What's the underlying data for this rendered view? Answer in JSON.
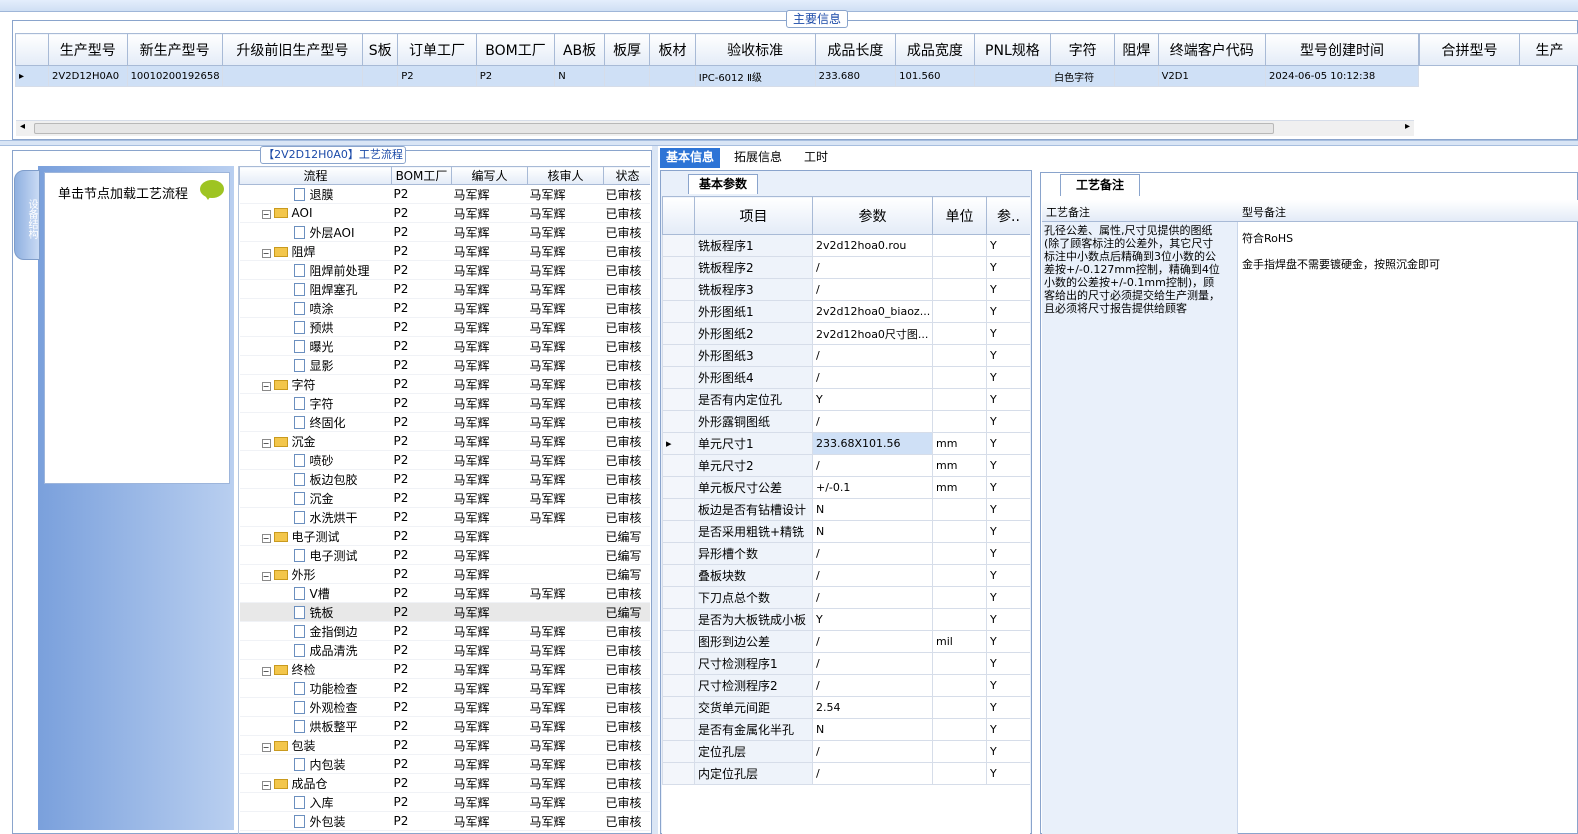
{
  "main_legend": "主要信息",
  "main_grid": {
    "columns": [
      "生产型号",
      "新生产型号",
      "升级前旧生产型号",
      "S板",
      "订单工厂",
      "BOM工厂",
      "AB板",
      "板厚",
      "板材",
      "验收标准",
      "成品长度",
      "成品宽度",
      "PNL规格",
      "字符",
      "阻焊",
      "终端客户代码",
      "型号创建时间"
    ],
    "row": [
      "2V2D12H0A0",
      "10010200192658",
      "",
      "",
      "P2",
      "P2",
      "N",
      "",
      "",
      "IPC-6012 Ⅱ级",
      "233.680",
      "101.560",
      "",
      "白色字符",
      "",
      "V2D1",
      "2024-06-05 10:12:38"
    ]
  },
  "right_grid_columns": [
    "合拼型号",
    "生产"
  ],
  "flow": {
    "legend": "【2V2D12H0A0】工艺流程",
    "sidebar_tab": "设备结构",
    "hint": "单击节点加载工艺流程",
    "columns": [
      "流程",
      "BOM工厂",
      "编写人",
      "核审人",
      "状态"
    ],
    "rows": [
      {
        "name": "退膜",
        "type": "doc",
        "bom": "P2",
        "author": "马军辉",
        "reviewer": "马军辉",
        "status": "已审核"
      },
      {
        "name": "AOI",
        "type": "folder",
        "bom": "P2",
        "author": "马军辉",
        "reviewer": "马军辉",
        "status": "已审核"
      },
      {
        "name": "外层AOI",
        "type": "doc",
        "bom": "P2",
        "author": "马军辉",
        "reviewer": "马军辉",
        "status": "已审核"
      },
      {
        "name": "阻焊",
        "type": "folder",
        "bom": "P2",
        "author": "马军辉",
        "reviewer": "马军辉",
        "status": "已审核"
      },
      {
        "name": "阻焊前处理",
        "type": "doc",
        "bom": "P2",
        "author": "马军辉",
        "reviewer": "马军辉",
        "status": "已审核"
      },
      {
        "name": "阻焊塞孔",
        "type": "doc",
        "bom": "P2",
        "author": "马军辉",
        "reviewer": "马军辉",
        "status": "已审核"
      },
      {
        "name": "喷涂",
        "type": "doc",
        "bom": "P2",
        "author": "马军辉",
        "reviewer": "马军辉",
        "status": "已审核"
      },
      {
        "name": "预烘",
        "type": "doc",
        "bom": "P2",
        "author": "马军辉",
        "reviewer": "马军辉",
        "status": "已审核"
      },
      {
        "name": "曝光",
        "type": "doc",
        "bom": "P2",
        "author": "马军辉",
        "reviewer": "马军辉",
        "status": "已审核"
      },
      {
        "name": "显影",
        "type": "doc",
        "bom": "P2",
        "author": "马军辉",
        "reviewer": "马军辉",
        "status": "已审核"
      },
      {
        "name": "字符",
        "type": "folder",
        "bom": "P2",
        "author": "马军辉",
        "reviewer": "马军辉",
        "status": "已审核"
      },
      {
        "name": "字符",
        "type": "doc",
        "bom": "P2",
        "author": "马军辉",
        "reviewer": "马军辉",
        "status": "已审核"
      },
      {
        "name": "终固化",
        "type": "doc",
        "bom": "P2",
        "author": "马军辉",
        "reviewer": "马军辉",
        "status": "已审核"
      },
      {
        "name": "沉金",
        "type": "folder",
        "bom": "P2",
        "author": "马军辉",
        "reviewer": "马军辉",
        "status": "已审核"
      },
      {
        "name": "喷砂",
        "type": "doc",
        "bom": "P2",
        "author": "马军辉",
        "reviewer": "马军辉",
        "status": "已审核"
      },
      {
        "name": "板边包胶",
        "type": "doc",
        "bom": "P2",
        "author": "马军辉",
        "reviewer": "马军辉",
        "status": "已审核"
      },
      {
        "name": "沉金",
        "type": "doc",
        "bom": "P2",
        "author": "马军辉",
        "reviewer": "马军辉",
        "status": "已审核"
      },
      {
        "name": "水洗烘干",
        "type": "doc",
        "bom": "P2",
        "author": "马军辉",
        "reviewer": "马军辉",
        "status": "已审核"
      },
      {
        "name": "电子测试",
        "type": "folder",
        "bom": "P2",
        "author": "马军辉",
        "reviewer": "",
        "status": "已编写"
      },
      {
        "name": "电子测试",
        "type": "doc",
        "bom": "P2",
        "author": "马军辉",
        "reviewer": "",
        "status": "已编写"
      },
      {
        "name": "外形",
        "type": "folder",
        "bom": "P2",
        "author": "马军辉",
        "reviewer": "",
        "status": "已编写"
      },
      {
        "name": "V槽",
        "type": "doc",
        "bom": "P2",
        "author": "马军辉",
        "reviewer": "马军辉",
        "status": "已审核"
      },
      {
        "name": "铣板",
        "type": "doc",
        "bom": "P2",
        "author": "马军辉",
        "reviewer": "",
        "status": "已编写",
        "selected": true
      },
      {
        "name": "金指倒边",
        "type": "doc",
        "bom": "P2",
        "author": "马军辉",
        "reviewer": "马军辉",
        "status": "已审核"
      },
      {
        "name": "成品清洗",
        "type": "doc",
        "bom": "P2",
        "author": "马军辉",
        "reviewer": "马军辉",
        "status": "已审核"
      },
      {
        "name": "终检",
        "type": "folder",
        "bom": "P2",
        "author": "马军辉",
        "reviewer": "马军辉",
        "status": "已审核"
      },
      {
        "name": "功能检查",
        "type": "doc",
        "bom": "P2",
        "author": "马军辉",
        "reviewer": "马军辉",
        "status": "已审核"
      },
      {
        "name": "外观检查",
        "type": "doc",
        "bom": "P2",
        "author": "马军辉",
        "reviewer": "马军辉",
        "status": "已审核"
      },
      {
        "name": "烘板整平",
        "type": "doc",
        "bom": "P2",
        "author": "马军辉",
        "reviewer": "马军辉",
        "status": "已审核"
      },
      {
        "name": "包装",
        "type": "folder",
        "bom": "P2",
        "author": "马军辉",
        "reviewer": "马军辉",
        "status": "已审核"
      },
      {
        "name": "内包装",
        "type": "doc",
        "bom": "P2",
        "author": "马军辉",
        "reviewer": "马军辉",
        "status": "已审核"
      },
      {
        "name": "成品仓",
        "type": "folder",
        "bom": "P2",
        "author": "马军辉",
        "reviewer": "马军辉",
        "status": "已审核"
      },
      {
        "name": "入库",
        "type": "doc",
        "bom": "P2",
        "author": "马军辉",
        "reviewer": "马军辉",
        "status": "已审核"
      },
      {
        "name": "外包装",
        "type": "doc",
        "bom": "P2",
        "author": "马军辉",
        "reviewer": "马军辉",
        "status": "已审核"
      }
    ]
  },
  "tabs": [
    "基本信息",
    "拓展信息",
    "工时"
  ],
  "param_tab": "基本参数",
  "param_grid": {
    "columns": [
      "项目",
      "参数",
      "单位",
      "参.."
    ],
    "rows": [
      {
        "item": "铣板程序1",
        "value": "2v2d12hoa0.rou",
        "unit": "",
        "flag": "Y"
      },
      {
        "item": "铣板程序2",
        "value": "/",
        "unit": "",
        "flag": "Y"
      },
      {
        "item": "铣板程序3",
        "value": "/",
        "unit": "",
        "flag": "Y"
      },
      {
        "item": "外形图纸1",
        "value": "2v2d12hoa0_biaoz...",
        "unit": "",
        "flag": "Y"
      },
      {
        "item": "外形图纸2",
        "value": "2v2d12hoa0尺寸图...",
        "unit": "",
        "flag": "Y"
      },
      {
        "item": "外形图纸3",
        "value": "/",
        "unit": "",
        "flag": "Y"
      },
      {
        "item": "外形图纸4",
        "value": "/",
        "unit": "",
        "flag": "Y"
      },
      {
        "item": "是否有内定位孔",
        "value": "Y",
        "unit": "",
        "flag": "Y"
      },
      {
        "item": "外形露铜图纸",
        "value": "/",
        "unit": "",
        "flag": "Y"
      },
      {
        "item": "单元尺寸1",
        "value": "233.68X101.56",
        "unit": "mm",
        "flag": "Y",
        "selected": true
      },
      {
        "item": "单元尺寸2",
        "value": "/",
        "unit": "mm",
        "flag": "Y"
      },
      {
        "item": "单元板尺寸公差",
        "value": "+/-0.1",
        "unit": "mm",
        "flag": "Y"
      },
      {
        "item": "板边是否有钻槽设计",
        "value": "N",
        "unit": "",
        "flag": "Y"
      },
      {
        "item": "是否采用粗铣+精铣",
        "value": "N",
        "unit": "",
        "flag": "Y"
      },
      {
        "item": "异形槽个数",
        "value": "/",
        "unit": "",
        "flag": "Y"
      },
      {
        "item": "叠板块数",
        "value": "/",
        "unit": "",
        "flag": "Y"
      },
      {
        "item": "下刀点总个数",
        "value": "/",
        "unit": "",
        "flag": "Y"
      },
      {
        "item": "是否为大板铣成小板",
        "value": "Y",
        "unit": "",
        "flag": "Y"
      },
      {
        "item": "图形到边公差",
        "value": "/",
        "unit": "mil",
        "flag": "Y"
      },
      {
        "item": "尺寸检测程序1",
        "value": "/",
        "unit": "",
        "flag": "Y"
      },
      {
        "item": "尺寸检测程序2",
        "value": "/",
        "unit": "",
        "flag": "Y"
      },
      {
        "item": "交货单元间距",
        "value": "2.54",
        "unit": "",
        "flag": "Y"
      },
      {
        "item": "是否有金属化半孔",
        "value": "N",
        "unit": "",
        "flag": "Y"
      },
      {
        "item": "定位孔层",
        "value": "/",
        "unit": "",
        "flag": "Y"
      },
      {
        "item": "内定位孔层",
        "value": "/",
        "unit": "",
        "flag": "Y"
      }
    ]
  },
  "craft_tab": "工艺备注",
  "remarks": {
    "craft_header": "工艺备注",
    "model_header": "型号备注",
    "craft_text": "孔径公差、属性,尺寸见提供的图纸(除了顾客标注的公差外，其它尺寸标注中小数点后精确到3位小数的公差按+/-0.127mm控制，精确到4位小数的公差按+/-0.1mm控制)，顾客给出的尺寸必须提交给生产测量，且必须将尺寸报告提供给顾客",
    "model_line1": "符合RoHS",
    "model_line2": "金手指焊盘不需要镀硬金，按照沉金即可"
  },
  "colors": {
    "accent": "#2d74d6",
    "selection": "#cfe0f6",
    "panel_blue": "#7aa0dc"
  }
}
